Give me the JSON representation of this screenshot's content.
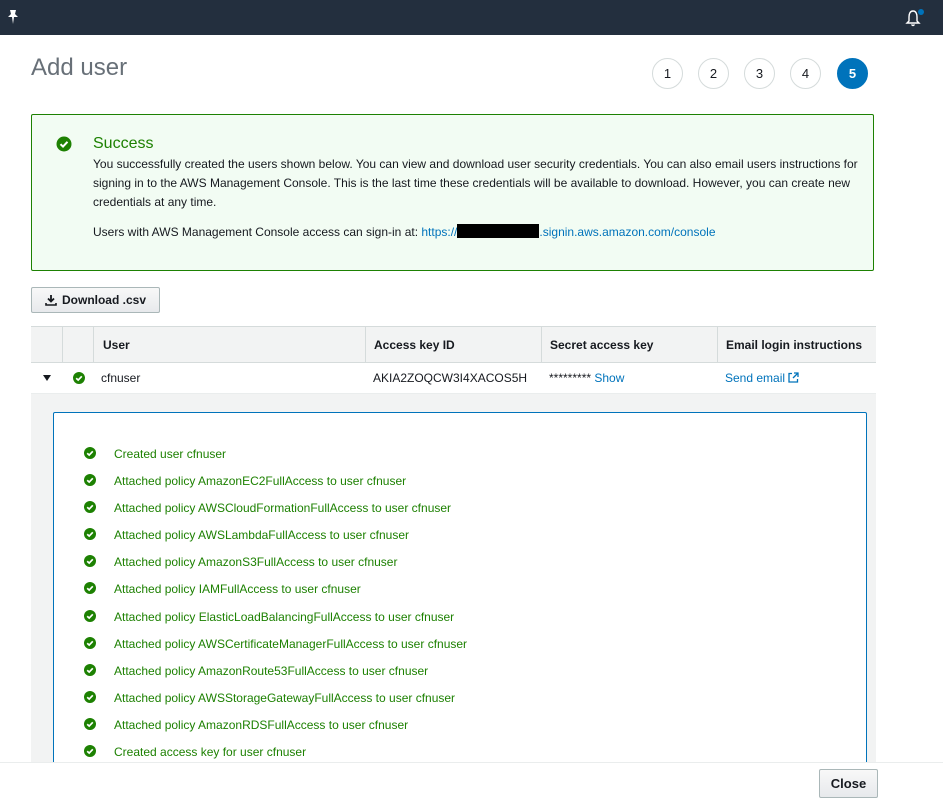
{
  "header": {
    "title": "Add user",
    "steps": [
      "1",
      "2",
      "3",
      "4",
      "5"
    ],
    "active_step": "5"
  },
  "success": {
    "title": "Success",
    "message": "You successfully created the users shown below. You can view and download user security credentials. You can also email users instructions for signing in to the AWS Management Console. This is the last time these credentials will be available to download. However, you can create new credentials at any time.",
    "signin_prefix": "Users with AWS Management Console access can sign-in at:",
    "signin_url_start": "https://",
    "signin_url_end": ".signin.aws.amazon.com/console"
  },
  "toolbar": {
    "download_label": "Download .csv"
  },
  "table": {
    "columns": [
      "User",
      "Access key ID",
      "Secret access key",
      "Email login instructions"
    ],
    "rows": [
      {
        "user": "cfnuser",
        "access_key_id": "AKIA2ZOQCW3I4XACOS5H",
        "secret_masked": "*********",
        "show_label": "Show",
        "email_label": "Send email"
      }
    ]
  },
  "log": [
    "Created user cfnuser",
    "Attached policy AmazonEC2FullAccess to user cfnuser",
    "Attached policy AWSCloudFormationFullAccess to user cfnuser",
    "Attached policy AWSLambdaFullAccess to user cfnuser",
    "Attached policy AmazonS3FullAccess to user cfnuser",
    "Attached policy IAMFullAccess to user cfnuser",
    "Attached policy ElasticLoadBalancingFullAccess to user cfnuser",
    "Attached policy AWSCertificateManagerFullAccess to user cfnuser",
    "Attached policy AmazonRoute53FullAccess to user cfnuser",
    "Attached policy AWSStorageGatewayFullAccess to user cfnuser",
    "Attached policy AmazonRDSFullAccess to user cfnuser",
    "Created access key for user cfnuser"
  ],
  "footer": {
    "close_label": "Close"
  },
  "colors": {
    "success": "#1d8102",
    "link": "#0073bb",
    "topbar": "#232f3e",
    "notification_dot": "#0073bb"
  }
}
